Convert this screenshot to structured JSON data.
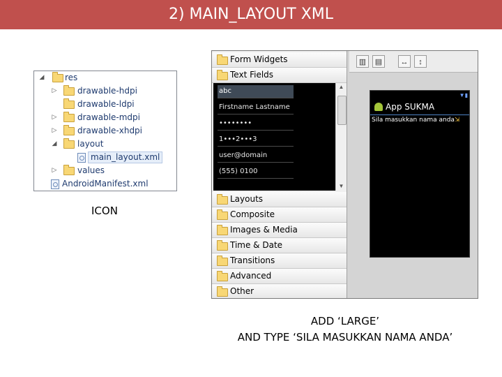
{
  "slide_title": "2) MAIN_LAYOUT XML",
  "project_tree": {
    "items": [
      {
        "label": "res",
        "arrow": "◢",
        "kind": "res-folder"
      },
      {
        "label": "drawable-hdpi",
        "arrow": "▷",
        "kind": "folder"
      },
      {
        "label": "drawable-ldpi",
        "arrow": "",
        "kind": "folder"
      },
      {
        "label": "drawable-mdpi",
        "arrow": "▷",
        "kind": "folder"
      },
      {
        "label": "drawable-xhdpi",
        "arrow": "▷",
        "kind": "folder"
      },
      {
        "label": "layout",
        "arrow": "◢",
        "kind": "folder"
      },
      {
        "label": "main_layout.xml",
        "arrow": "",
        "kind": "file"
      },
      {
        "label": "values",
        "arrow": "▷",
        "kind": "folder"
      },
      {
        "label": "AndroidManifest.xml",
        "arrow": "",
        "kind": "file"
      }
    ]
  },
  "icon_caption": "ICON",
  "palette": {
    "categories_top": [
      "Form Widgets",
      "Text Fields"
    ],
    "text_fields": [
      "abc",
      "Firstname Lastname",
      "••••••••",
      "1•••2•••3",
      "user@domain",
      "(555) 0100"
    ],
    "categories_bottom": [
      "Layouts",
      "Composite",
      "Images & Media",
      "Time & Date",
      "Transitions",
      "Advanced",
      "Other"
    ]
  },
  "device": {
    "app_title": "App SUKMA",
    "screen_text": "Sila masukkan nama anda"
  },
  "instructions": {
    "line1": "ADD ‘LARGE’",
    "line2": "AND TYPE ‘SILA MASUKKAN NAMA ANDA’"
  },
  "colors": {
    "title_bar": "#c0504d",
    "android_green": "#a4c639",
    "action_bar_line": "#4f83c4"
  }
}
